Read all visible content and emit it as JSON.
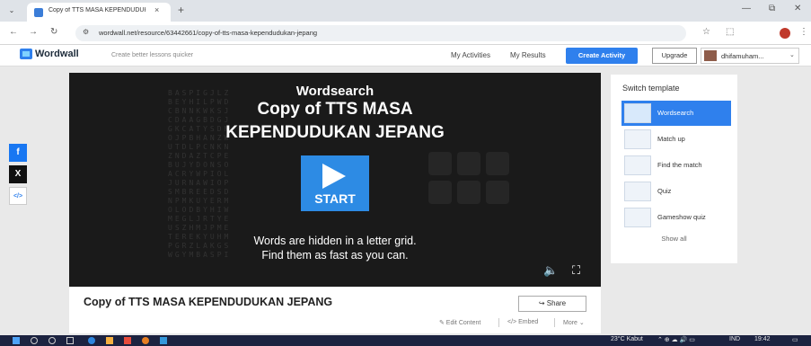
{
  "browser": {
    "tab_title": "Copy of TTS MASA KEPENDUDUK",
    "tab_close": "×",
    "new_tab": "+",
    "menu_icon": "chevron-down-icon",
    "url_scheme_icon": "site-settings-icon",
    "url": "wordwall.net/resource/63442661/copy-of-tts-masa-kependudukan-jepang",
    "nav": {
      "back": "←",
      "forward": "→",
      "reload": "↻"
    },
    "controls": {
      "minimize": "—",
      "restore": "⧉",
      "close": "✕"
    },
    "toolbar": {
      "star": "☆",
      "extensions": "⬚",
      "menu": "⋮"
    }
  },
  "header": {
    "logo": "Wordwall",
    "tagline": "Create better lessons quicker",
    "my_activities": "My Activities",
    "my_results": "My Results",
    "create_activity": "Create Activity",
    "upgrade": "Upgrade",
    "username": "dhifamuham...",
    "caret": "⌄",
    "accent": "#2f80ed"
  },
  "social": {
    "facebook": "f",
    "x": "X",
    "embed": "</>",
    "facebook_color": "#1877f2",
    "x_color": "#111111"
  },
  "game": {
    "template_name": "Wordsearch",
    "title_line1": "Copy of TTS MASA",
    "title_line2": "KEPENDUDUKAN JEPANG",
    "start_label": "START",
    "desc_line1": "Words are hidden in a letter grid.",
    "desc_line2": "Find them as fast as you can.",
    "sound_icon": "🔈",
    "fullscreen_icon": "⛶",
    "start_color": "#2d8be4"
  },
  "info": {
    "title": "Copy of TTS MASA KEPENDUDUKAN JEPANG",
    "share": "↪ Share",
    "edit": "✎ Edit Content",
    "embed": "</> Embed",
    "more": "More ⌄"
  },
  "panel": {
    "heading": "Switch template",
    "templates": [
      {
        "label": "Wordsearch",
        "active": true
      },
      {
        "label": "Match up",
        "active": false
      },
      {
        "label": "Find the match",
        "active": false
      },
      {
        "label": "Quiz",
        "active": false
      },
      {
        "label": "Gameshow quiz",
        "active": false
      }
    ],
    "show_all": "Show all"
  },
  "taskbar": {
    "weather": "23°C Kabut",
    "tray_icons": "⌃ ⊕ ☁ 🔊 ▭",
    "lang": "IND",
    "time": "19:42",
    "notification_icon": "▭"
  }
}
